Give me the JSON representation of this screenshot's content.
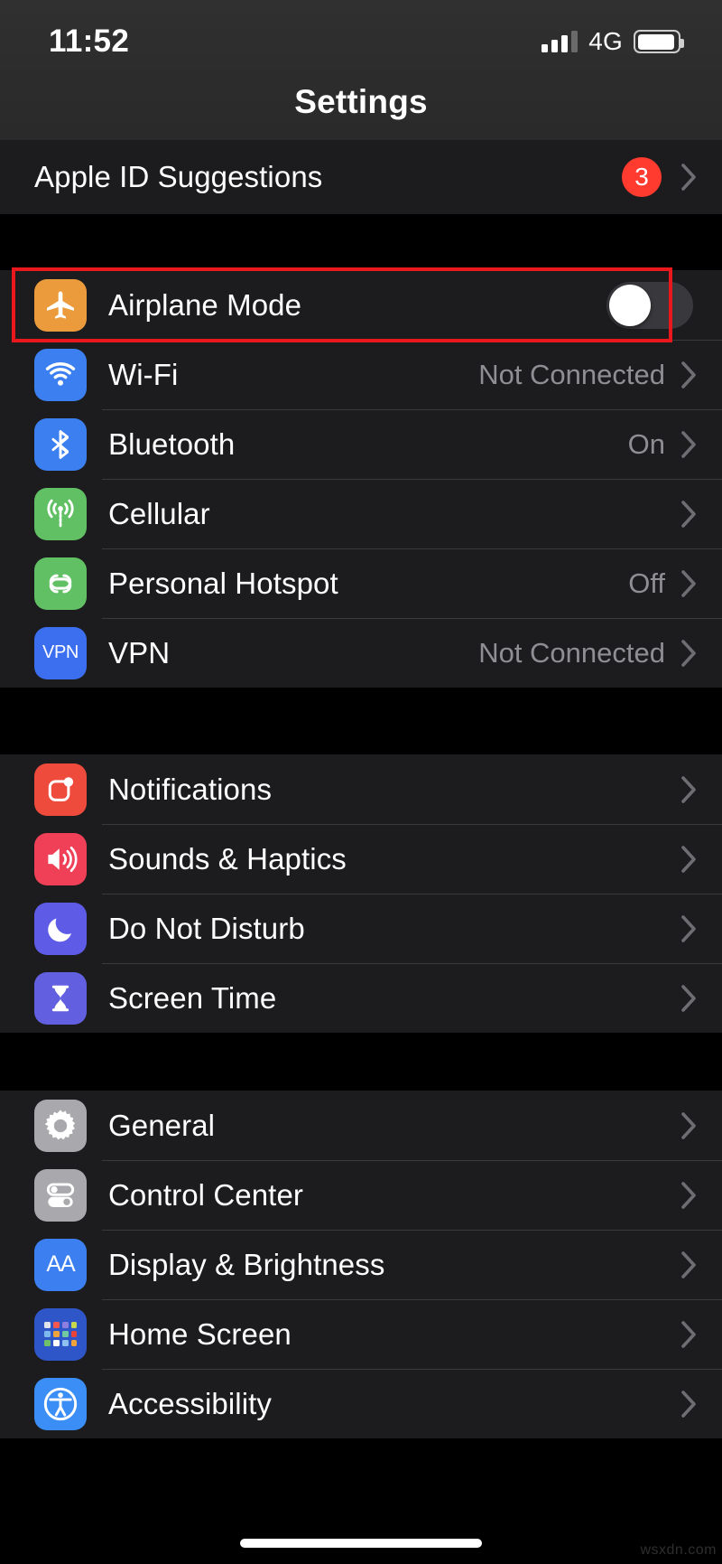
{
  "status_bar": {
    "time": "11:52",
    "network_label": "4G",
    "signal_icon": "signal-bars-icon",
    "battery_icon": "battery-icon",
    "signal_bars_filled": 3,
    "signal_bars_total": 4
  },
  "nav": {
    "title": "Settings"
  },
  "colors": {
    "row_bg": "#1c1c1e",
    "section_gap": "#000000",
    "separator": "#3a3a3c",
    "value_text": "#8e8e93",
    "badge_red": "#ff3b30",
    "highlight_red": "#e8181c",
    "toggle_off_track": "#39393d",
    "toggle_knob": "#ffffff"
  },
  "highlight": {
    "target": "Airplane Mode",
    "shape": "rectangle",
    "color": "#e8181c"
  },
  "sections": [
    {
      "id": "suggestions",
      "rows": [
        {
          "label": "Apple ID Suggestions",
          "badge": "3",
          "icon": null,
          "value": "",
          "accessory": "chevron"
        }
      ]
    },
    {
      "id": "connectivity",
      "rows": [
        {
          "label": "Airplane Mode",
          "icon": "airplane-icon",
          "icon_color": "#eb9a3c",
          "value": "",
          "accessory": "toggle",
          "toggle_state": "off",
          "highlighted": true
        },
        {
          "label": "Wi-Fi",
          "icon": "wifi-icon",
          "icon_color": "#3b7ff0",
          "value": "Not Connected",
          "accessory": "chevron"
        },
        {
          "label": "Bluetooth",
          "icon": "bluetooth-icon",
          "icon_color": "#3b7ff0",
          "value": "On",
          "accessory": "chevron"
        },
        {
          "label": "Cellular",
          "icon": "cellular-antenna-icon",
          "icon_color": "#62c064",
          "value": "",
          "accessory": "chevron"
        },
        {
          "label": "Personal Hotspot",
          "icon": "hotspot-link-icon",
          "icon_color": "#62c064",
          "value": "Off",
          "accessory": "chevron"
        },
        {
          "label": "VPN",
          "icon": "vpn-icon",
          "icon_color": "#3b6ff0",
          "value": "Not Connected",
          "accessory": "chevron"
        }
      ]
    },
    {
      "id": "alerts",
      "rows": [
        {
          "label": "Notifications",
          "icon": "notifications-icon",
          "icon_color": "#ef4b3c",
          "value": "",
          "accessory": "chevron"
        },
        {
          "label": "Sounds & Haptics",
          "icon": "sounds-speaker-icon",
          "icon_color": "#ef4058",
          "value": "",
          "accessory": "chevron"
        },
        {
          "label": "Do Not Disturb",
          "icon": "moon-icon",
          "icon_color": "#5e5ce6",
          "value": "",
          "accessory": "chevron"
        },
        {
          "label": "Screen Time",
          "icon": "hourglass-icon",
          "icon_color": "#6260e0",
          "value": "",
          "accessory": "chevron"
        }
      ]
    },
    {
      "id": "system",
      "rows": [
        {
          "label": "General",
          "icon": "gear-icon",
          "icon_color": "#a8a8ad",
          "value": "",
          "accessory": "chevron"
        },
        {
          "label": "Control Center",
          "icon": "control-center-toggles-icon",
          "icon_color": "#a8a8ad",
          "value": "",
          "accessory": "chevron"
        },
        {
          "label": "Display & Brightness",
          "icon": "display-aa-icon",
          "icon_color": "#3b7ff0",
          "value": "",
          "accessory": "chevron"
        },
        {
          "label": "Home Screen",
          "icon": "home-screen-grid-icon",
          "icon_color": "#2f56c8",
          "value": "",
          "accessory": "chevron"
        },
        {
          "label": "Accessibility",
          "icon": "accessibility-icon",
          "icon_color": "#3b8ef5",
          "value": "",
          "accessory": "chevron"
        }
      ]
    }
  ],
  "watermark": "wsxdn.com"
}
